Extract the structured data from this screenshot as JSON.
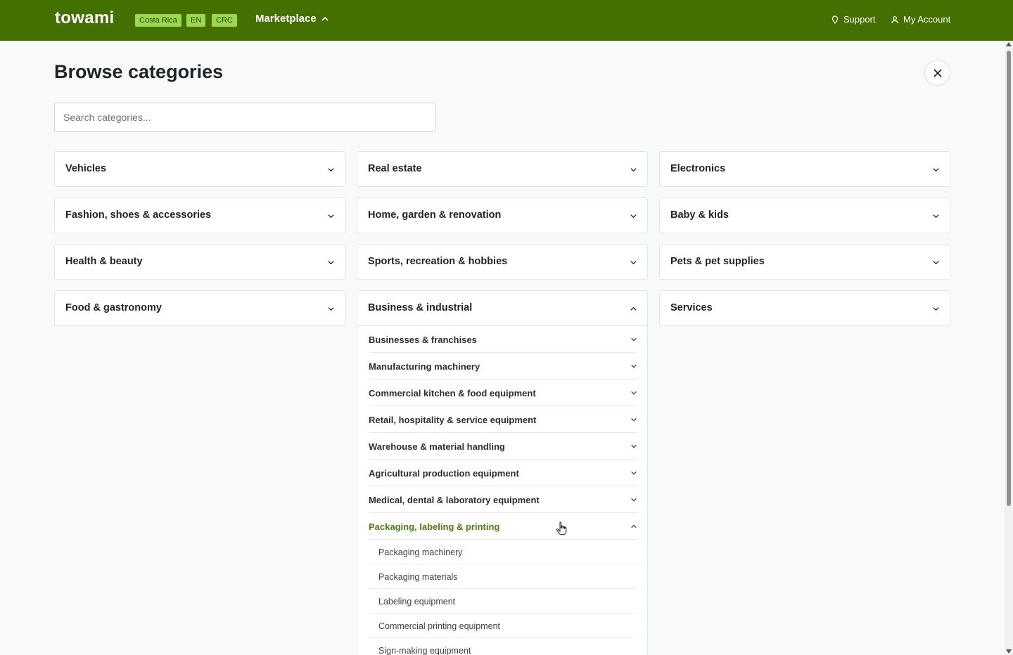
{
  "header": {
    "brand": "towami",
    "country": "Costa Rica",
    "language": "EN",
    "currency": "CRC",
    "marketplace_label": "Marketplace",
    "support_label": "Support",
    "account_label": "My Account",
    "bar_color": "#437000",
    "pill_color": "#9bd84f"
  },
  "page": {
    "title": "Browse categories",
    "search_placeholder": "Search categories..."
  },
  "categories": [
    {
      "label": "Vehicles"
    },
    {
      "label": "Real estate"
    },
    {
      "label": "Electronics"
    },
    {
      "label": "Fashion, shoes & accessories"
    },
    {
      "label": "Home, garden & renovation"
    },
    {
      "label": "Baby & kids"
    },
    {
      "label": "Health & beauty"
    },
    {
      "label": "Sports, recreation & hobbies"
    },
    {
      "label": "Pets & pet supplies"
    },
    {
      "label": "Food & gastronomy"
    },
    {
      "label": "Business & industrial",
      "expanded": true
    },
    {
      "label": "Services"
    }
  ],
  "business_subcategories": [
    {
      "label": "Businesses & franchises"
    },
    {
      "label": "Manufacturing machinery"
    },
    {
      "label": "Commercial kitchen & food equipment"
    },
    {
      "label": "Retail, hospitality & service equipment"
    },
    {
      "label": "Warehouse & material handling"
    },
    {
      "label": "Agricultural production equipment"
    },
    {
      "label": "Medical, dental & laboratory equipment"
    },
    {
      "label": "Packaging, labeling & printing",
      "expanded": true
    }
  ],
  "packaging_items": [
    {
      "label": "Packaging machinery"
    },
    {
      "label": "Packaging materials"
    },
    {
      "label": "Labeling equipment"
    },
    {
      "label": "Commercial printing equipment"
    },
    {
      "label": "Sign-making equipment"
    }
  ],
  "colors": {
    "active_text": "#4d7c0f"
  }
}
